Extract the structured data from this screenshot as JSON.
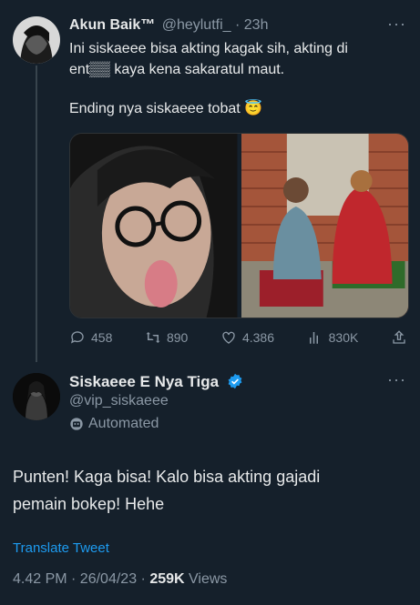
{
  "tweet1": {
    "display_name": "Akun Baik™",
    "handle": "@heylutfi_",
    "time": "23h",
    "text_line1": "Ini siskaeee bisa akting kagak sih, akting di",
    "text_line2": "ent▒▒ kaya kena sakaratul maut.",
    "text_line3": "Ending nya siskaeee tobat 😇",
    "actions": {
      "replies": "458",
      "retweets": "890",
      "likes": "4.386",
      "views": "830K"
    }
  },
  "tweet2": {
    "display_name": "Siskaeee E Nya Tiga",
    "handle": "@vip_siskaeee",
    "automated_label": "Automated",
    "text_line1": "Punten! Kaga bisa! Kalo bisa akting gajadi",
    "text_line2": "pemain bokep! Hehe",
    "translate_label": "Translate Tweet",
    "timestamp": "4.42 PM · 26/04/23 · ",
    "views_count": "259K",
    "views_label": " Views"
  },
  "colors": {
    "background": "#15202b",
    "text": "#e7e9ea",
    "muted": "#8b98a5",
    "accent": "#1d9bf0"
  },
  "icons": [
    "more-icon",
    "reply-icon",
    "retweet-icon",
    "like-icon",
    "views-icon",
    "share-icon",
    "verified-icon",
    "robot-icon"
  ]
}
